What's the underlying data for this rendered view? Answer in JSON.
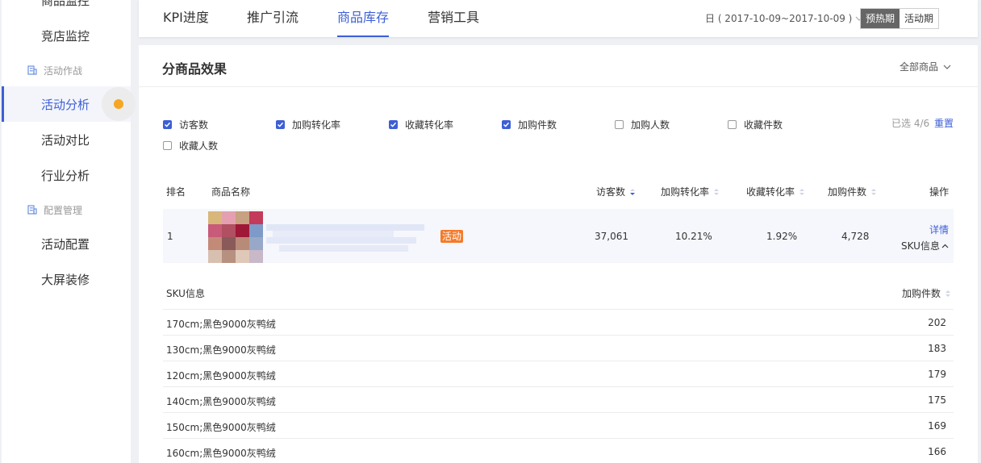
{
  "sidebar": {
    "items_top": [
      {
        "label": "商品监控"
      },
      {
        "label": "竞店监控"
      }
    ],
    "group_activity": "活动作战",
    "activity_items": [
      {
        "label": "活动分析"
      },
      {
        "label": "活动对比"
      },
      {
        "label": "行业分析"
      }
    ],
    "group_config": "配置管理",
    "config_items": [
      {
        "label": "活动配置"
      },
      {
        "label": "大屏装修"
      }
    ],
    "accent_color": "#3d5fd6"
  },
  "topbar": {
    "tabs": [
      {
        "label": "KPI进度"
      },
      {
        "label": "推广引流"
      },
      {
        "label": "商品库存"
      },
      {
        "label": "营销工具"
      }
    ],
    "active_tab": "商品库存",
    "date_range": "日 ( 2017-10-09~2017-10-09 )",
    "period_preheat": "预热期",
    "period_activity": "活动期"
  },
  "card": {
    "title": "分商品效果",
    "filter_label": "全部商品",
    "metrics": [
      {
        "label": "访客数",
        "checked": true
      },
      {
        "label": "加购转化率",
        "checked": true
      },
      {
        "label": "收藏转化率",
        "checked": true
      },
      {
        "label": "加购件数",
        "checked": true
      },
      {
        "label": "加购人数",
        "checked": false
      },
      {
        "label": "收藏件数",
        "checked": false
      },
      {
        "label": "收藏人数",
        "checked": false
      }
    ],
    "selected_info": "已选 4/6",
    "reset_label": "重置",
    "columns": {
      "rank": "排名",
      "name": "商品名称",
      "visitors": "访客数",
      "cart_rate": "加购转化率",
      "fav_rate": "收藏转化率",
      "cart_qty": "加购件数",
      "action": "操作"
    },
    "row": {
      "rank": "1",
      "tag": "活动",
      "visitors": "37,061",
      "cart_rate": "10.21%",
      "fav_rate": "1.92%",
      "cart_qty": "4,728",
      "detail_link": "详情",
      "sku_link": "SKU信息"
    },
    "sku_table": {
      "col_sku": "SKU信息",
      "col_qty": "加购件数",
      "rows": [
        {
          "sku": "170cm;黑色9000灰鸭绒",
          "qty": "202"
        },
        {
          "sku": "130cm;黑色9000灰鸭绒",
          "qty": "183"
        },
        {
          "sku": "120cm;黑色9000灰鸭绒",
          "qty": "179"
        },
        {
          "sku": "140cm;黑色9000灰鸭绒",
          "qty": "175"
        },
        {
          "sku": "150cm;黑色9000灰鸭绒",
          "qty": "169"
        },
        {
          "sku": "160cm;黑色9000灰鸭绒",
          "qty": "166"
        }
      ]
    }
  }
}
